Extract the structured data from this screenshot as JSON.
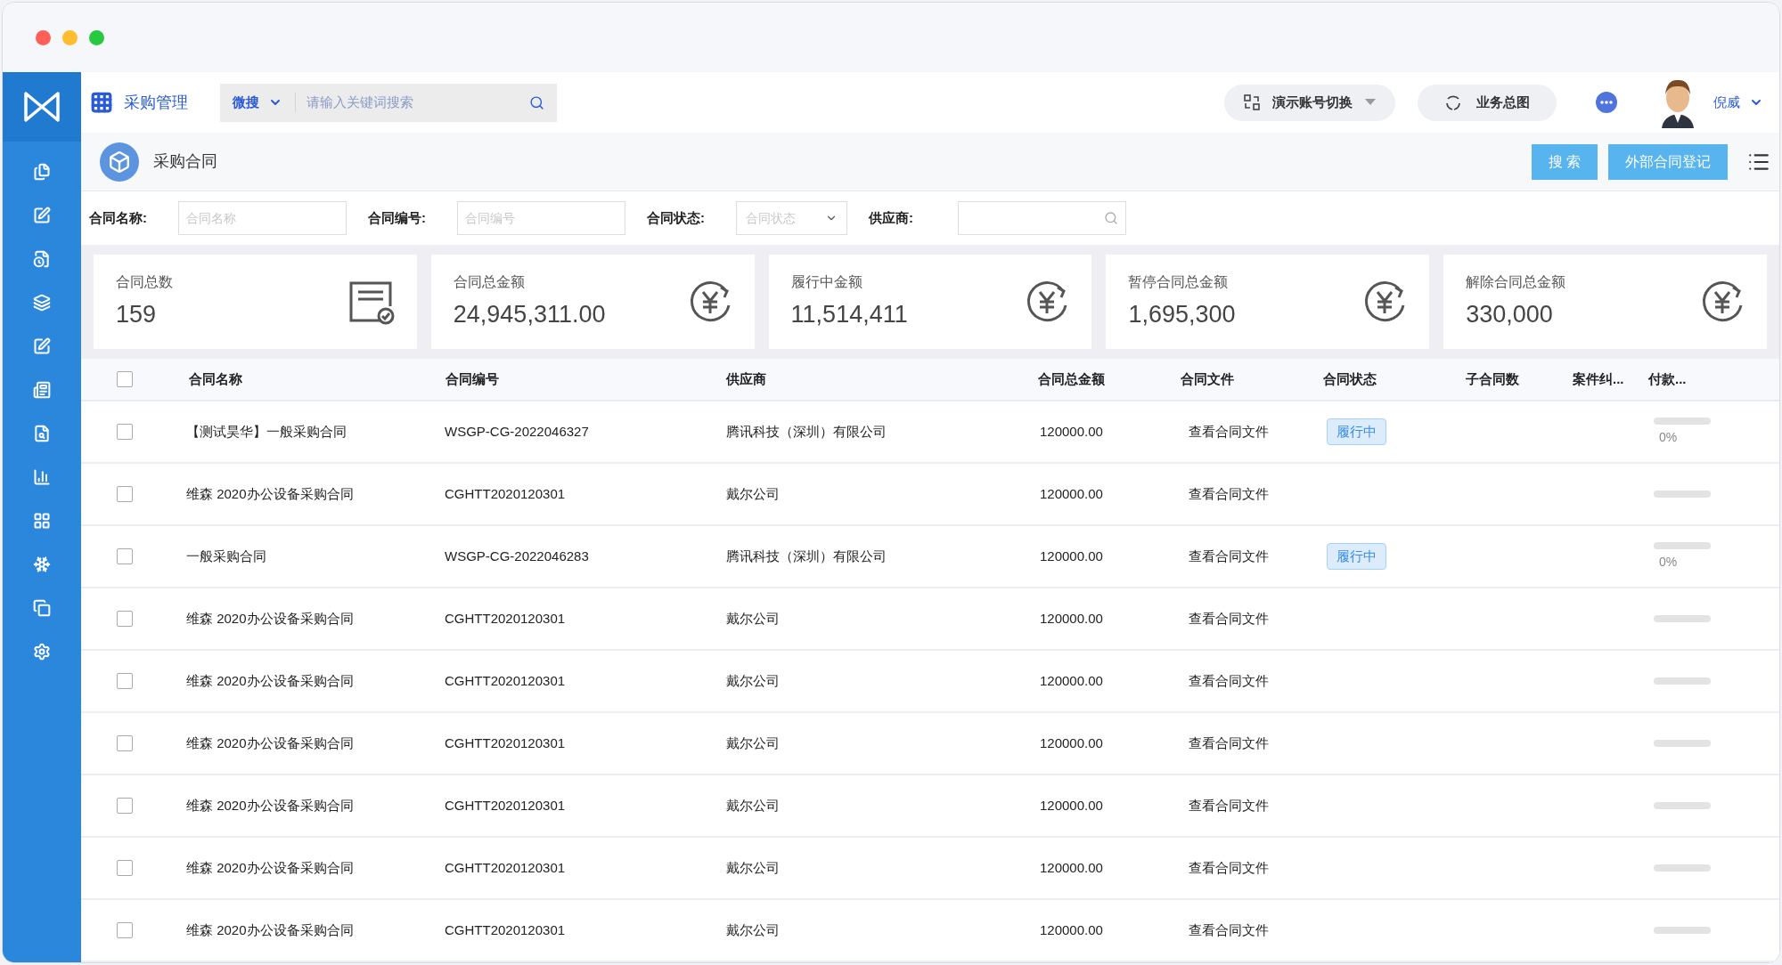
{
  "header": {
    "module": "采购管理",
    "search_scope": "微搜",
    "search_placeholder": "请输入关键词搜索",
    "account_switch": "演示账号切换",
    "overview": "业务总图",
    "user": "倪威"
  },
  "sidebar": {
    "items": [
      {
        "kind": "files",
        "selected": false
      },
      {
        "kind": "edit",
        "selected": false
      },
      {
        "kind": "doc-clock",
        "selected": false
      },
      {
        "kind": "layers",
        "selected": false
      },
      {
        "kind": "pen-square",
        "selected": false
      },
      {
        "kind": "newspaper",
        "selected": false
      },
      {
        "kind": "doc-search",
        "selected": false
      },
      {
        "kind": "chart",
        "selected": false
      },
      {
        "kind": "grid",
        "selected": false
      },
      {
        "kind": "snowflake",
        "selected": false
      },
      {
        "kind": "copy",
        "selected": false
      },
      {
        "kind": "settings",
        "selected": false
      }
    ]
  },
  "page": {
    "title": "采购合同",
    "buttons": [
      "搜 索",
      "外部合同登记"
    ]
  },
  "filters": [
    {
      "kind": "text",
      "label": "合同名称:",
      "placeholder": "合同名称"
    },
    {
      "kind": "text",
      "label": "合同编号:",
      "placeholder": "合同编号"
    },
    {
      "kind": "select",
      "label": "合同状态:",
      "placeholder": "合同状态"
    },
    {
      "kind": "search",
      "label": "供应商:"
    }
  ],
  "stats": [
    {
      "kind": "document",
      "label": "合同总数",
      "value": "159"
    },
    {
      "kind": "yen",
      "label": "合同总金额",
      "value": "24,945,311.00"
    },
    {
      "kind": "yen",
      "label": "履行中金额",
      "value": "11,514,411"
    },
    {
      "kind": "yen",
      "label": "暂停合同总金额",
      "value": "1,695,300"
    },
    {
      "kind": "yen",
      "label": "解除合同总金额",
      "value": "330,000"
    }
  ],
  "table": {
    "select_all_checked": false,
    "columns": [
      "合同名称",
      "合同编号",
      "供应商",
      "合同总金额",
      "合同文件",
      "合同状态",
      "子合同数",
      "案件纠...",
      "付款..."
    ],
    "rows": [
      {
        "checked": false,
        "name": "【测试昊华】一般采购合同",
        "number": "WSGP-CG-2022046327",
        "supplier": "腾讯科技（深圳）有限公司",
        "amount": "120000.00",
        "file": "查看合同文件",
        "status": "履行中",
        "level": 0,
        "percent": "0%"
      },
      {
        "checked": false,
        "name": "维森 2020办公设备采购合同",
        "number": "CGHTT2020120301",
        "supplier": "戴尔公司",
        "amount": "120000.00",
        "file": "查看合同文件",
        "level": 0
      },
      {
        "checked": false,
        "name": "一般采购合同",
        "number": "WSGP-CG-2022046283",
        "supplier": "腾讯科技（深圳）有限公司",
        "amount": "120000.00",
        "file": "查看合同文件",
        "status": "履行中",
        "level": 0,
        "percent": "0%"
      },
      {
        "checked": false,
        "name": "维森 2020办公设备采购合同",
        "number": "CGHTT2020120301",
        "supplier": "戴尔公司",
        "amount": "120000.00",
        "file": "查看合同文件",
        "level": 0
      },
      {
        "checked": false,
        "name": "维森 2020办公设备采购合同",
        "number": "CGHTT2020120301",
        "supplier": "戴尔公司",
        "amount": "120000.00",
        "file": "查看合同文件",
        "level": 0
      },
      {
        "checked": false,
        "name": "维森 2020办公设备采购合同",
        "number": "CGHTT2020120301",
        "supplier": "戴尔公司",
        "amount": "120000.00",
        "file": "查看合同文件",
        "level": 0
      },
      {
        "checked": false,
        "name": "维森 2020办公设备采购合同",
        "number": "CGHTT2020120301",
        "supplier": "戴尔公司",
        "amount": "120000.00",
        "file": "查看合同文件",
        "level": 0
      },
      {
        "checked": false,
        "name": "维森 2020办公设备采购合同",
        "number": "CGHTT2020120301",
        "supplier": "戴尔公司",
        "amount": "120000.00",
        "file": "查看合同文件",
        "level": 0
      },
      {
        "checked": false,
        "name": "维森 2020办公设备采购合同",
        "number": "CGHTT2020120301",
        "supplier": "戴尔公司",
        "amount": "120000.00",
        "file": "查看合同文件",
        "level": 0
      }
    ]
  }
}
